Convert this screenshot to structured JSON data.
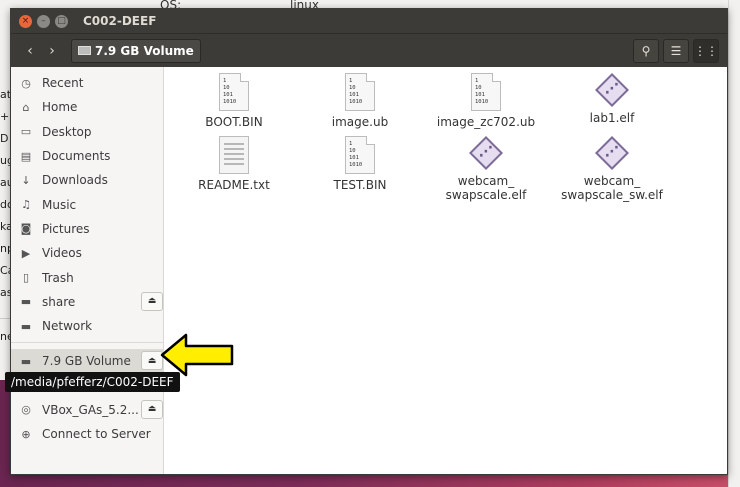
{
  "background": {
    "top_left_text": "OS:",
    "top_right_text": "linux",
    "side_letters": [
      "at",
      "+",
      "D",
      "ug",
      "au",
      "dc",
      "ka",
      "np",
      "Ca",
      "as"
    ],
    "lower_label": "ne"
  },
  "window": {
    "title": "C002-DEEF",
    "controls": {
      "close": "×",
      "minimize": "–",
      "maximize": "□"
    }
  },
  "toolbar": {
    "back_icon": "‹",
    "forward_icon": "›",
    "path_label": "7.9 GB Volume",
    "search_icon": "⚲",
    "list_view_icon": "☰",
    "grid_view_icon": "⋮⋮"
  },
  "sidebar": {
    "items": [
      {
        "label": "Recent",
        "icon": "clock-icon",
        "glyph": "◷"
      },
      {
        "label": "Home",
        "icon": "home-icon",
        "glyph": "⌂"
      },
      {
        "label": "Desktop",
        "icon": "desktop-icon",
        "glyph": "▭"
      },
      {
        "label": "Documents",
        "icon": "documents-icon",
        "glyph": "▤"
      },
      {
        "label": "Downloads",
        "icon": "download-icon",
        "glyph": "↓"
      },
      {
        "label": "Music",
        "icon": "music-icon",
        "glyph": "♫"
      },
      {
        "label": "Pictures",
        "icon": "camera-icon",
        "glyph": "◙"
      },
      {
        "label": "Videos",
        "icon": "video-icon",
        "glyph": "▶"
      },
      {
        "label": "Trash",
        "icon": "trash-icon",
        "glyph": "▯"
      },
      {
        "label": "share",
        "icon": "drive-icon",
        "glyph": "▬",
        "eject": "⏏"
      },
      {
        "label": "Network",
        "icon": "network-icon",
        "glyph": "▬"
      }
    ],
    "devices": [
      {
        "label": "7.9 GB Volume",
        "icon": "drive-icon",
        "glyph": "▬",
        "eject": "⏏",
        "selected": true
      },
      {
        "label": "VBox_GAs_5.2...",
        "icon": "disc-icon",
        "glyph": "◎",
        "eject": "⏏"
      },
      {
        "label": "Connect to Server",
        "icon": "server-icon",
        "glyph": "⊕"
      }
    ]
  },
  "files": [
    {
      "name": "BOOT.BIN",
      "type": "binary"
    },
    {
      "name": "image.ub",
      "type": "binary"
    },
    {
      "name": "image_zc702.ub",
      "type": "binary"
    },
    {
      "name": "lab1.elf",
      "type": "elf"
    },
    {
      "name": "README.txt",
      "type": "text"
    },
    {
      "name": "TEST.BIN",
      "type": "binary"
    },
    {
      "name": "webcam_\nswapscale.elf",
      "type": "elf"
    },
    {
      "name": "webcam_\nswapscale_sw.elf",
      "type": "elf"
    }
  ],
  "binary_icon_text": "1\n10\n101\n1010",
  "tooltip": "/media/pfefferz/C002-DEEF",
  "colors": {
    "titlebar": "#3c3b37",
    "close_button": "#e9653b",
    "arrow_fill": "#ffee00",
    "arrow_stroke": "#000000"
  }
}
